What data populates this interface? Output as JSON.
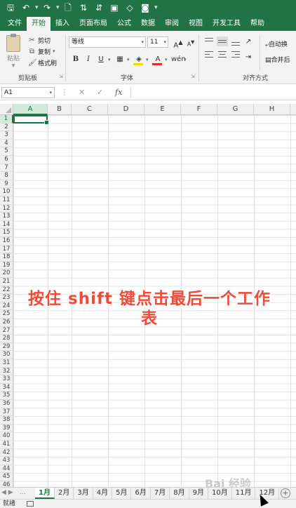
{
  "quick_access": [
    {
      "name": "save-icon",
      "glyph": "💾"
    },
    {
      "name": "undo-icon",
      "glyph": "↶"
    },
    {
      "name": "redo-icon",
      "glyph": "↷"
    },
    {
      "name": "print-preview-icon",
      "glyph": "🔍"
    },
    {
      "name": "sort-icon",
      "glyph": "⇅"
    },
    {
      "name": "sort-desc-icon",
      "glyph": "⇵"
    },
    {
      "name": "picture-icon",
      "glyph": "▣"
    },
    {
      "name": "shape-icon",
      "glyph": "◇"
    },
    {
      "name": "camera-icon",
      "glyph": "📷"
    }
  ],
  "tabs": [
    "文件",
    "开始",
    "插入",
    "页面布局",
    "公式",
    "数据",
    "审阅",
    "视图",
    "开发工具",
    "帮助"
  ],
  "active_tab": "开始",
  "ribbon": {
    "paste_label": "粘贴",
    "cut_label": "剪切",
    "copy_label": "复制",
    "format_painter_label": "格式刷",
    "clipboard_group": "剪贴板",
    "font_name": "等线",
    "font_size": "11",
    "font_group": "字体",
    "bold": "B",
    "italic": "I",
    "underline": "U",
    "align_group": "对齐方式",
    "wrap_text": "自动换",
    "merge": "合并后"
  },
  "formula_bar": {
    "name_box": "A1",
    "cancel": "✕",
    "enter": "✓",
    "fx": "fx",
    "value": ""
  },
  "columns": [
    "A",
    "B",
    "C",
    "D",
    "E",
    "F",
    "G",
    "H"
  ],
  "active_column": "A",
  "rows": [
    "1",
    "2",
    "3",
    "4",
    "5",
    "6",
    "7",
    "8",
    "9",
    "10",
    "11",
    "12",
    "13",
    "14",
    "15",
    "16",
    "17",
    "18",
    "19",
    "20",
    "21",
    "22",
    "23",
    "24",
    "25",
    "26",
    "27",
    "28",
    "29",
    "30",
    "31",
    "32",
    "33",
    "34",
    "35",
    "36",
    "37",
    "38",
    "39",
    "40",
    "41",
    "42",
    "43",
    "44",
    "45",
    "46"
  ],
  "active_row": "1",
  "overlay_text_line1": "按住 shift 键点击最后一个工作",
  "overlay_text_line2": "表",
  "sheets": [
    "1月",
    "2月",
    "3月",
    "4月",
    "5月",
    "6月",
    "7月",
    "8月",
    "9月",
    "10月",
    "11月",
    "12月"
  ],
  "active_sheet": "1月",
  "add_sheet": "+",
  "status": "就绪",
  "watermark": "Bai 经验",
  "colors": {
    "accent": "#217346",
    "overlay_text": "#f04b3a"
  }
}
